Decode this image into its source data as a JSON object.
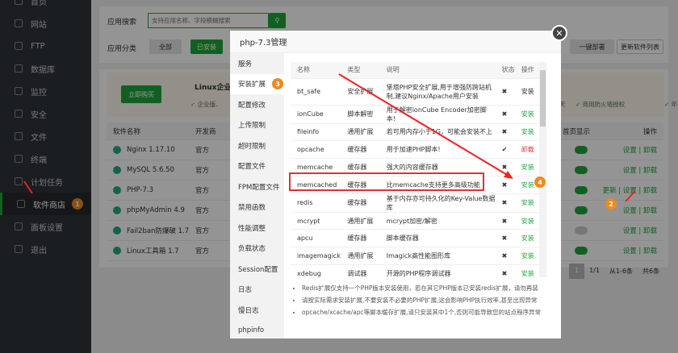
{
  "sidebar": {
    "items": [
      {
        "label": "首页"
      },
      {
        "label": "网站"
      },
      {
        "label": "FTP"
      },
      {
        "label": "数据库"
      },
      {
        "label": "监控"
      },
      {
        "label": "安全"
      },
      {
        "label": "文件"
      },
      {
        "label": "终端"
      },
      {
        "label": "计划任务"
      },
      {
        "label": "软件商店",
        "badge": "1",
        "active": true
      },
      {
        "label": "面板设置"
      },
      {
        "label": "退出"
      }
    ]
  },
  "search": {
    "label": "应用搜索",
    "placeholder": "支持应用名称、字段模糊搜索"
  },
  "category": {
    "label": "应用分类",
    "all": "全部",
    "installed": "已安装",
    "deploy": "一键部署",
    "update_list": "更新软件列表"
  },
  "banner": {
    "buy": "立即购买",
    "title": "Linux企业",
    "f1": "✓ 企业版、",
    "f2": "天",
    "f3": "✓ 商用防火墙授权",
    "f4": "✓ 年"
  },
  "software_table": {
    "headers": [
      "软件名称",
      "开发商",
      "首页显示",
      "操作"
    ],
    "rows": [
      {
        "name": "Nginx 1.17.10",
        "dev": "官方",
        "ops": "设置 | 卸载",
        "on": true
      },
      {
        "name": "MySQL 5.6.50",
        "dev": "官方",
        "ops": "设置 | 卸载",
        "on": true
      },
      {
        "name": "PHP-7.3",
        "dev": "官方",
        "ops": "更新 | 设置 | 卸载",
        "on": true
      },
      {
        "name": "phpMyAdmin 4.9",
        "dev": "官方",
        "ops": "设置 | 卸载",
        "on": true
      },
      {
        "name": "Fail2ban防爆破 1.7",
        "dev": "官方",
        "ops": "设置 | 卸载",
        "on": false
      },
      {
        "name": "Linux工具箱 1.7",
        "dev": "官方",
        "ops": "设置 | 卸载",
        "on": true
      }
    ]
  },
  "pagination": {
    "page": "1",
    "pages": "1/1",
    "range": "从1-6条",
    "total": "共6条"
  },
  "step_badges": {
    "b2": "2",
    "b3": "3",
    "b4": "4"
  },
  "modal": {
    "title": "php-7.3管理",
    "close": "✕",
    "nav": [
      "服务",
      "安装扩展",
      "配置修改",
      "上传限制",
      "超时限制",
      "配置文件",
      "FPM配置文件",
      "禁用函数",
      "性能调整",
      "负载状态",
      "Session配置",
      "日志",
      "慢日志",
      "phpinfo"
    ],
    "headers": [
      "名称",
      "类型",
      "说明",
      "状态",
      "操作"
    ],
    "extensions": [
      {
        "name": "bt_safe",
        "type": "安全扩展",
        "desc": "堡塔PHP安全扩展,用于增强防跨站机制,建议Nginx/Apache用户安装",
        "status": "✖",
        "op": "安装"
      },
      {
        "name": "ionCube",
        "type": "脚本解密",
        "desc": "用于解密ionCube Encoder加密脚本!",
        "status": "✖",
        "op": "安装"
      },
      {
        "name": "fileinfo",
        "type": "通用扩展",
        "desc": "若可用内存小于1G，可能会安装不上",
        "status": "✖",
        "op": "安装"
      },
      {
        "name": "opcache",
        "type": "缓存器",
        "desc": "用于加速PHP脚本!",
        "status": "✔",
        "op": "卸载"
      },
      {
        "name": "memcache",
        "type": "缓存器",
        "desc": "强大的内容缓存器",
        "status": "✖",
        "op": "安装"
      },
      {
        "name": "memcached",
        "type": "缓存器",
        "desc": "比memcache支持更多高级功能",
        "status": "✖",
        "op": "安装"
      },
      {
        "name": "redis",
        "type": "缓存器",
        "desc": "基于内存亦可持久化的Key-Value数据库",
        "status": "✖",
        "op": "安装"
      },
      {
        "name": "mcrypt",
        "type": "通用扩展",
        "desc": "mcrypt加密/解密",
        "status": "✖",
        "op": "安装"
      },
      {
        "name": "apcu",
        "type": "缓存器",
        "desc": "脚本缓存器",
        "status": "✖",
        "op": "安装"
      },
      {
        "name": "imagemagick",
        "type": "通用扩展",
        "desc": "Imagick高性能图形库",
        "status": "✖",
        "op": "安装"
      },
      {
        "name": "xdebug",
        "type": "调试器",
        "desc": "开源的PHP程序调试器",
        "status": "✖",
        "op": "安装"
      }
    ],
    "notes": [
      "Redis扩展仅支持一个PHP版本安装使用，若在其它PHP版本已安装redis扩展，请勿再装",
      "请按实际需求安装扩展,不要安装不必要的PHP扩展,这会影响PHP执行效率,甚至出现异常",
      "opcache/xcache/apc等脚本缓存扩展,请只安装其中1个,否则可能导致您的站点程序异常"
    ]
  }
}
